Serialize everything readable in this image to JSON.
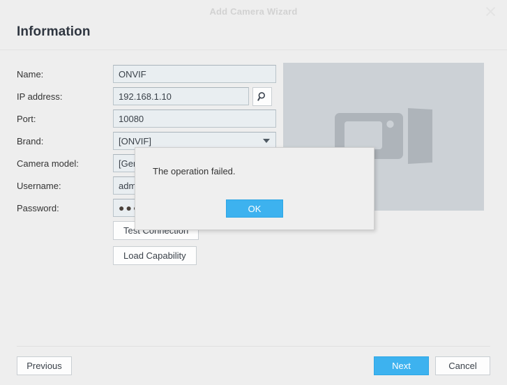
{
  "window": {
    "title": "Add Camera Wizard",
    "close_icon": "close-icon"
  },
  "page": {
    "heading": "Information"
  },
  "form": {
    "fields": [
      {
        "label": "Name:",
        "value": "ONVIF",
        "placeholder": ""
      },
      {
        "label": "IP address:",
        "value": "192.168.1.10",
        "placeholder": ""
      },
      {
        "label": "Port:",
        "value": "10080",
        "placeholder": ""
      },
      {
        "label": "Brand:",
        "value": "[ONVIF]",
        "placeholder": ""
      },
      {
        "label": "Camera model:",
        "value": "[Generic_ONVIF]",
        "placeholder": ""
      },
      {
        "label": "Username:",
        "value": "admin",
        "placeholder": ""
      },
      {
        "label": "Password:",
        "value": "●●●●●●",
        "placeholder": ""
      }
    ],
    "search_button_icon": "search-icon",
    "brand_caret_icon": "chevron-down-icon",
    "test_connection_label": "Test Connection",
    "load_capability_label": "Load Capability"
  },
  "preview": {
    "icon": "camera-placeholder-icon"
  },
  "dialog": {
    "message": "The operation failed.",
    "ok_label": "OK"
  },
  "footer": {
    "previous_label": "Previous",
    "next_label": "Next",
    "cancel_label": "Cancel"
  },
  "colors": {
    "accent": "#3db2ef",
    "window_bg": "#eeeeee",
    "field_bg": "#e9eef1",
    "preview_bg": "#ccd1d6",
    "title_text": "#d2d2d2"
  }
}
